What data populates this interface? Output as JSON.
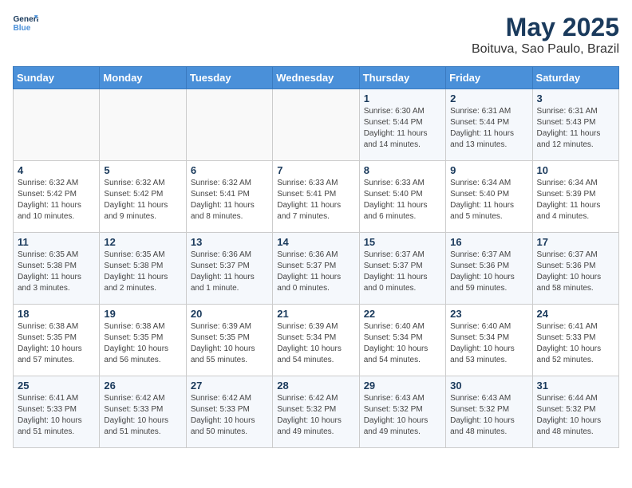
{
  "header": {
    "logo_line1": "General",
    "logo_line2": "Blue",
    "title": "May 2025",
    "subtitle": "Boituva, Sao Paulo, Brazil"
  },
  "weekdays": [
    "Sunday",
    "Monday",
    "Tuesday",
    "Wednesday",
    "Thursday",
    "Friday",
    "Saturday"
  ],
  "weeks": [
    [
      {
        "day": "",
        "info": ""
      },
      {
        "day": "",
        "info": ""
      },
      {
        "day": "",
        "info": ""
      },
      {
        "day": "",
        "info": ""
      },
      {
        "day": "1",
        "info": "Sunrise: 6:30 AM\nSunset: 5:44 PM\nDaylight: 11 hours and 14 minutes."
      },
      {
        "day": "2",
        "info": "Sunrise: 6:31 AM\nSunset: 5:44 PM\nDaylight: 11 hours and 13 minutes."
      },
      {
        "day": "3",
        "info": "Sunrise: 6:31 AM\nSunset: 5:43 PM\nDaylight: 11 hours and 12 minutes."
      }
    ],
    [
      {
        "day": "4",
        "info": "Sunrise: 6:32 AM\nSunset: 5:42 PM\nDaylight: 11 hours and 10 minutes."
      },
      {
        "day": "5",
        "info": "Sunrise: 6:32 AM\nSunset: 5:42 PM\nDaylight: 11 hours and 9 minutes."
      },
      {
        "day": "6",
        "info": "Sunrise: 6:32 AM\nSunset: 5:41 PM\nDaylight: 11 hours and 8 minutes."
      },
      {
        "day": "7",
        "info": "Sunrise: 6:33 AM\nSunset: 5:41 PM\nDaylight: 11 hours and 7 minutes."
      },
      {
        "day": "8",
        "info": "Sunrise: 6:33 AM\nSunset: 5:40 PM\nDaylight: 11 hours and 6 minutes."
      },
      {
        "day": "9",
        "info": "Sunrise: 6:34 AM\nSunset: 5:40 PM\nDaylight: 11 hours and 5 minutes."
      },
      {
        "day": "10",
        "info": "Sunrise: 6:34 AM\nSunset: 5:39 PM\nDaylight: 11 hours and 4 minutes."
      }
    ],
    [
      {
        "day": "11",
        "info": "Sunrise: 6:35 AM\nSunset: 5:38 PM\nDaylight: 11 hours and 3 minutes."
      },
      {
        "day": "12",
        "info": "Sunrise: 6:35 AM\nSunset: 5:38 PM\nDaylight: 11 hours and 2 minutes."
      },
      {
        "day": "13",
        "info": "Sunrise: 6:36 AM\nSunset: 5:37 PM\nDaylight: 11 hours and 1 minute."
      },
      {
        "day": "14",
        "info": "Sunrise: 6:36 AM\nSunset: 5:37 PM\nDaylight: 11 hours and 0 minutes."
      },
      {
        "day": "15",
        "info": "Sunrise: 6:37 AM\nSunset: 5:37 PM\nDaylight: 11 hours and 0 minutes."
      },
      {
        "day": "16",
        "info": "Sunrise: 6:37 AM\nSunset: 5:36 PM\nDaylight: 10 hours and 59 minutes."
      },
      {
        "day": "17",
        "info": "Sunrise: 6:37 AM\nSunset: 5:36 PM\nDaylight: 10 hours and 58 minutes."
      }
    ],
    [
      {
        "day": "18",
        "info": "Sunrise: 6:38 AM\nSunset: 5:35 PM\nDaylight: 10 hours and 57 minutes."
      },
      {
        "day": "19",
        "info": "Sunrise: 6:38 AM\nSunset: 5:35 PM\nDaylight: 10 hours and 56 minutes."
      },
      {
        "day": "20",
        "info": "Sunrise: 6:39 AM\nSunset: 5:35 PM\nDaylight: 10 hours and 55 minutes."
      },
      {
        "day": "21",
        "info": "Sunrise: 6:39 AM\nSunset: 5:34 PM\nDaylight: 10 hours and 54 minutes."
      },
      {
        "day": "22",
        "info": "Sunrise: 6:40 AM\nSunset: 5:34 PM\nDaylight: 10 hours and 54 minutes."
      },
      {
        "day": "23",
        "info": "Sunrise: 6:40 AM\nSunset: 5:34 PM\nDaylight: 10 hours and 53 minutes."
      },
      {
        "day": "24",
        "info": "Sunrise: 6:41 AM\nSunset: 5:33 PM\nDaylight: 10 hours and 52 minutes."
      }
    ],
    [
      {
        "day": "25",
        "info": "Sunrise: 6:41 AM\nSunset: 5:33 PM\nDaylight: 10 hours and 51 minutes."
      },
      {
        "day": "26",
        "info": "Sunrise: 6:42 AM\nSunset: 5:33 PM\nDaylight: 10 hours and 51 minutes."
      },
      {
        "day": "27",
        "info": "Sunrise: 6:42 AM\nSunset: 5:33 PM\nDaylight: 10 hours and 50 minutes."
      },
      {
        "day": "28",
        "info": "Sunrise: 6:42 AM\nSunset: 5:32 PM\nDaylight: 10 hours and 49 minutes."
      },
      {
        "day": "29",
        "info": "Sunrise: 6:43 AM\nSunset: 5:32 PM\nDaylight: 10 hours and 49 minutes."
      },
      {
        "day": "30",
        "info": "Sunrise: 6:43 AM\nSunset: 5:32 PM\nDaylight: 10 hours and 48 minutes."
      },
      {
        "day": "31",
        "info": "Sunrise: 6:44 AM\nSunset: 5:32 PM\nDaylight: 10 hours and 48 minutes."
      }
    ]
  ]
}
